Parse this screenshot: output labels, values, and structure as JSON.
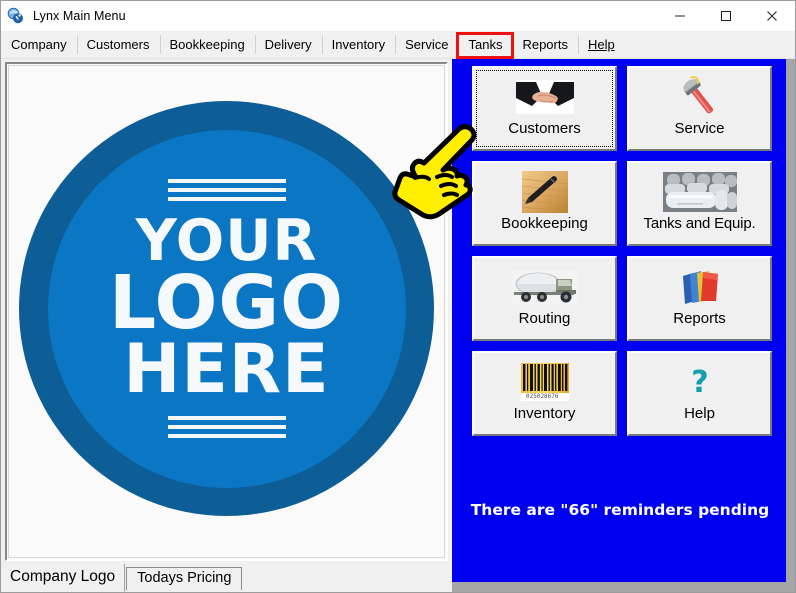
{
  "window": {
    "title": "Lynx Main Menu",
    "icon": "app-globe-icon",
    "controls": {
      "minimize": "minimize-icon",
      "maximize": "maximize-icon",
      "close": "close-icon"
    }
  },
  "menu": {
    "items": [
      {
        "label": "Company",
        "name": "menu-company"
      },
      {
        "label": "Customers",
        "name": "menu-customers"
      },
      {
        "label": "Bookkeeping",
        "name": "menu-bookkeeping"
      },
      {
        "label": "Delivery",
        "name": "menu-delivery"
      },
      {
        "label": "Inventory",
        "name": "menu-inventory"
      },
      {
        "label": "Service",
        "name": "menu-service"
      },
      {
        "label": "Tanks",
        "name": "menu-tanks",
        "highlighted": true
      },
      {
        "label": "Reports",
        "name": "menu-reports"
      },
      {
        "label": "Help",
        "name": "menu-help",
        "accelerator": "H"
      }
    ],
    "highlight_color": "#ee1111"
  },
  "logo": {
    "line1": "YOUR",
    "line2": "LOGO",
    "line3": "HERE",
    "outer_ring_color": "#0d5d96",
    "inner_circle_color": "#0b76c4",
    "text_color": "#f6f9fb"
  },
  "tabs": [
    {
      "label": "Company Logo",
      "name": "tab-company-logo",
      "active": true
    },
    {
      "label": "Todays Pricing",
      "name": "tab-todays-pricing",
      "active": false
    }
  ],
  "panel": {
    "background_color": "#0000f0",
    "buttons": [
      {
        "label": "Customers",
        "icon": "handshake-icon",
        "name": "button-customers",
        "focused": true
      },
      {
        "label": "Service",
        "icon": "pipe-wrench-icon",
        "name": "button-service",
        "focused": false
      },
      {
        "label": "Bookkeeping",
        "icon": "ledger-pen-icon",
        "name": "button-bookkeeping",
        "focused": false
      },
      {
        "label": "Tanks and Equip.",
        "icon": "propane-tanks-icon",
        "name": "button-tanks-and-equip",
        "focused": false
      },
      {
        "label": "Routing",
        "icon": "tanker-truck-icon",
        "name": "button-routing",
        "focused": false
      },
      {
        "label": "Reports",
        "icon": "folders-icon",
        "name": "button-reports",
        "focused": false
      },
      {
        "label": "Inventory",
        "icon": "barcode-icon",
        "name": "button-inventory",
        "focused": false
      },
      {
        "label": "Help",
        "icon": "question-mark-icon",
        "name": "button-help",
        "focused": false
      }
    ],
    "reminder_text": "There are \"66\" reminders pending",
    "reminder_color": "#ffffff"
  },
  "cursor": {
    "type": "pointing-hand-cursor",
    "color": "#ffee00"
  }
}
